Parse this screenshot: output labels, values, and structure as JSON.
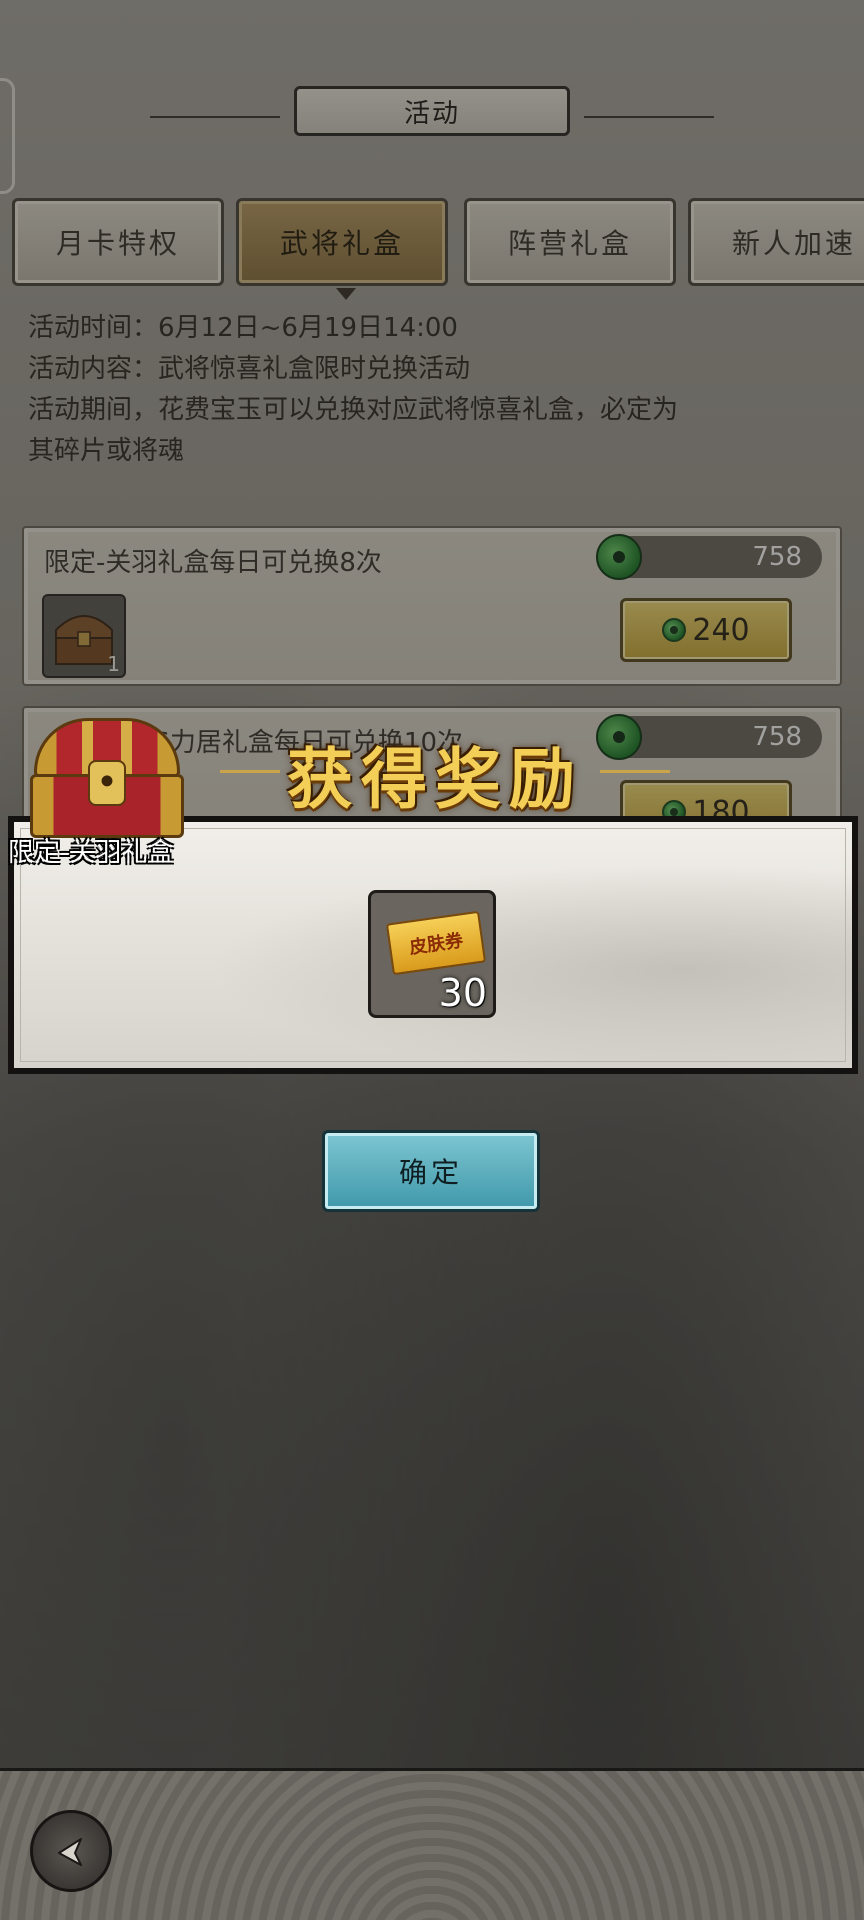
{
  "header": {
    "title": "活动"
  },
  "tabs": [
    {
      "label": "月卡特权",
      "active": false
    },
    {
      "label": "武将礼盒",
      "active": true
    },
    {
      "label": "阵营礼盒",
      "active": false
    },
    {
      "label": "新人加速",
      "active": false
    }
  ],
  "info": {
    "line1": "活动时间：6月12日~6月19日14:00",
    "line2": "活动内容：武将惊喜礼盒限时兑换活动",
    "line3": "活动期间，花费宝玉可以兑换对应武将惊喜礼盒，必定为",
    "line4": "其碎片或将魂"
  },
  "cards": [
    {
      "title": "限定-关羽礼盒每日可兑换8次",
      "item_count": "1",
      "balance": "758",
      "price": "240"
    },
    {
      "title": "-6力居礼盒每日可兑换10次",
      "balance": "758",
      "price": "180"
    }
  ],
  "reward_popup": {
    "banner": "获得奖励",
    "source_label": "限定-关羽礼盒",
    "item_label": "皮肤券",
    "item_count": "30",
    "confirm_label": "确定"
  },
  "colors": {
    "gold_button": "#d9bd50",
    "confirm_button": "#5bb0c0",
    "jade_coin": "#2a8a35",
    "banner_text": "#f3cf58"
  },
  "icons": {
    "back": "back-arrow-icon",
    "coin": "jade-coin-icon",
    "chest": "treasure-chest-icon",
    "ticket": "skin-ticket-icon"
  }
}
